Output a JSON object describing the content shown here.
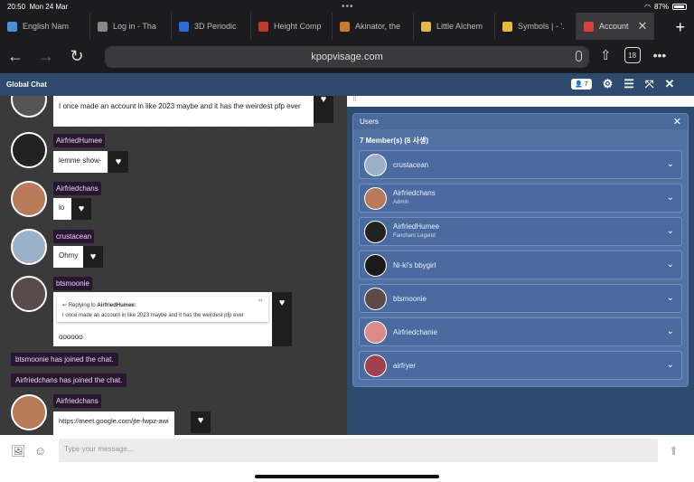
{
  "status": {
    "time": "20:50",
    "date": "Mon 24 Mar",
    "battery": "87%"
  },
  "tabs": [
    {
      "label": "English Nam",
      "color": "#4a90d9"
    },
    {
      "label": "Log in - Tha",
      "color": "#888888"
    },
    {
      "label": "3D Periodic",
      "color": "#2b6cd9"
    },
    {
      "label": "Height Comp",
      "color": "#c0392b"
    },
    {
      "label": "Akinator, the",
      "color": "#c77b2b"
    },
    {
      "label": "Little Alchem",
      "color": "#e0b84a"
    },
    {
      "label": "Symbols | - '.",
      "color": "#e8b93a"
    },
    {
      "label": "Account",
      "color": "#d94040"
    }
  ],
  "browser": {
    "url": "kpopvisage.com",
    "tab_count": "18"
  },
  "app": {
    "title": "Global Chat",
    "member_badge": "7"
  },
  "chat": {
    "messages": [
      {
        "text": "I once made an account in like 2023 maybe and it has the weirdest pfp ever"
      },
      {
        "user": "AirfriedHumee",
        "text": "lemme show-",
        "avatar": "#222222"
      },
      {
        "user": "Airfriedchans",
        "text": "lo",
        "avatar": "#b97a5a"
      },
      {
        "user": "crustacean",
        "text": "Ohmy",
        "avatar": "#9bb0c9"
      },
      {
        "user": "btsmoonie",
        "text": "oooooo",
        "avatar": "#5a4a4a",
        "reply_label": "Replying to",
        "reply_user": "AirfriedHumee:",
        "reply_text": "I once made an account in like 2023 maybe and it has the weirdest pfp ever"
      },
      {
        "user": "Airfriedchans",
        "text": "https://meet.google.com/jte-fwpz-awi",
        "avatar": "#b97a5a"
      }
    ],
    "system": [
      "btsmoonie has joined the chat.",
      "Airfriedchans has joined the chat."
    ],
    "input_placeholder": "Type your message..."
  },
  "users_panel": {
    "title": "Users",
    "count": "7 Member(s) (8 사생)",
    "members": [
      {
        "name": "crustacean",
        "role": "",
        "avatar": "#9bb0c9"
      },
      {
        "name": "Airfriedchans",
        "role": "Admin",
        "avatar": "#b97a5a"
      },
      {
        "name": "AirfriedHumee",
        "role": "Fanchant Legend",
        "avatar": "#222222"
      },
      {
        "name": "Ni-ki's bbygirl",
        "role": "",
        "avatar": "#1a1a1a"
      },
      {
        "name": "btsmoonie",
        "role": "",
        "avatar": "#5a4a4a"
      },
      {
        "name": "Airfriedchanie",
        "role": "",
        "avatar": "#d98a8a"
      },
      {
        "name": "airfryer",
        "role": "",
        "avatar": "#a04050"
      }
    ]
  }
}
